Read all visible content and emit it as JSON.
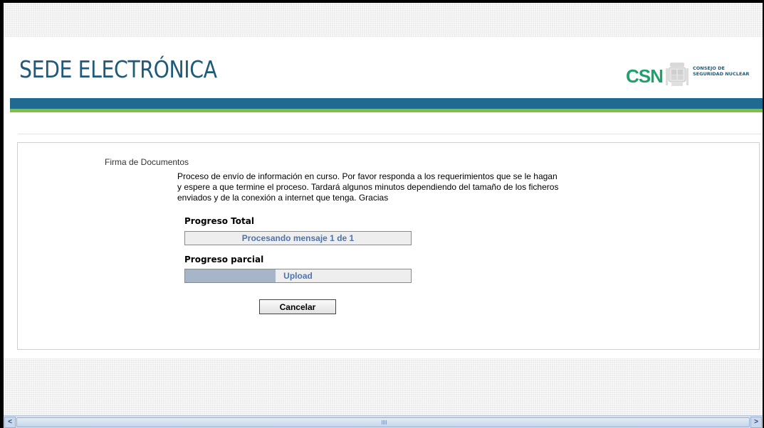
{
  "header": {
    "title": "SEDE ELECTRÓNICA",
    "logo": {
      "abbr": "CSN",
      "line1": "CONSEJO DE",
      "line2": "SEGURIDAD NUCLEAR",
      "icon": "coat-of-arms-icon"
    }
  },
  "colors": {
    "title": "#1f5a7a",
    "bar_blue": "#1f6a8e",
    "bar_green": "#7cc240",
    "logo_green": "#22a06c",
    "progress_text": "#4d74ad"
  },
  "main": {
    "section_label": "Firma de Documentos",
    "description": "Proceso de envío de información en curso. Por favor responda a los requerimientos que se le hagan y espere a que termine el proceso. Tardará algunos minutos dependiendo del tamaño de los ficheros enviados y de la conexión a internet que tenga. Gracias",
    "total": {
      "label": "Progreso Total",
      "status": "Procesando mensaje 1 de 1",
      "fill_fraction": 0
    },
    "partial": {
      "label": "Progreso parcial",
      "status": "Upload",
      "fill_fraction": 0.4
    },
    "cancel_label": "Cancelar"
  },
  "scrollbar": {
    "left_arrow": "<",
    "right_arrow": ">"
  }
}
